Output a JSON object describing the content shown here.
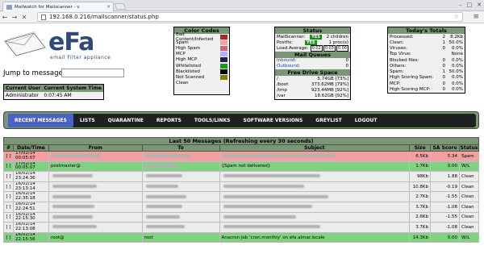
{
  "browser": {
    "tab_title": "Mailwatch for Mailscanner - v",
    "url": "192.168.0.216/mailscanner/status.php",
    "back": "←",
    "forward": "→",
    "reload": "✕",
    "menu": "≡",
    "star": "☆"
  },
  "logo": {
    "text": "eFa",
    "subtitle": "email Filter appliance"
  },
  "jump": {
    "label": "Jump to message:",
    "value": ""
  },
  "user_table": {
    "headers": [
      "Current User",
      "Current System Time"
    ],
    "user": "Administrator",
    "time": "0:07:45 AM"
  },
  "color_codes": {
    "title": "Color Codes",
    "items": [
      {
        "label": "Bad Content/Infected",
        "color": "#b22222"
      },
      {
        "label": "Spam",
        "color": "#f2a0a0"
      },
      {
        "label": "High Spam",
        "color": "#e0607a"
      },
      {
        "label": "MCP",
        "color": "#b0b0ff"
      },
      {
        "label": "High MCP",
        "color": "#202060"
      },
      {
        "label": "Whitelisted",
        "color": "#10a010"
      },
      {
        "label": "Blacklisted",
        "color": "#000000"
      },
      {
        "label": "Not Scanned",
        "color": "#808000"
      },
      {
        "label": "Clean",
        "color": "#f0f0f0"
      }
    ]
  },
  "status": {
    "title": "Status",
    "rows": [
      {
        "label": "MailScanner:",
        "badge": "YES",
        "value": "2 children"
      },
      {
        "label": "Postfix:",
        "badge": "YES",
        "value": "1 proc(s)"
      }
    ],
    "load_label": "Load Average:",
    "load": [
      "0.02",
      "0.03",
      "0.00"
    ]
  },
  "queues": {
    "title": "Mail Queues",
    "rows": [
      {
        "label": "Inbound:",
        "value": "0"
      },
      {
        "label": "Outbound:",
        "value": "0"
      }
    ]
  },
  "drives": {
    "title": "Free Drive Space",
    "rows": [
      {
        "label": "/",
        "value": "5.74GB [73%]"
      },
      {
        "label": "/boot",
        "value": "373.62MB [79%]"
      },
      {
        "label": "/tmp",
        "value": "923.44MB [92%]"
      },
      {
        "label": "/var",
        "value": "18.62GB [92%]"
      }
    ]
  },
  "totals": {
    "title": "Today's Totals",
    "rows": [
      {
        "label": "Processed:",
        "n": "2",
        "v": "8.2Kb"
      },
      {
        "label": "Clean:",
        "n": "1",
        "v": "50.0%"
      },
      {
        "label": "Viruses:",
        "n": "0",
        "v": "0.0%"
      },
      {
        "label": "Top Virus:",
        "n": "",
        "v": "None"
      },
      {
        "label": "Blocked files:",
        "n": "0",
        "v": "0.0%"
      },
      {
        "label": "Others:",
        "n": "0",
        "v": "0.0%"
      },
      {
        "label": "Spam:",
        "n": "1",
        "v": "50.0%"
      },
      {
        "label": "High Scoring Spam:",
        "n": "0",
        "v": "0.0%"
      },
      {
        "label": "MCP:",
        "n": "0",
        "v": "0.0%"
      },
      {
        "label": "High Scoring MCP:",
        "n": "0",
        "v": "0.0%"
      }
    ]
  },
  "nav": [
    "RECENT MESSAGES",
    "LISTS",
    "QUARANTINE",
    "REPORTS",
    "TOOLS/LINKS",
    "SOFTWARE VERSIONS",
    "GREYLIST",
    "LOGOUT"
  ],
  "messages": {
    "caption": "Last 50 Messages (Refreshing every 30 seconds)",
    "headers": [
      "#",
      "Date/Time",
      "From",
      "To",
      "Subject",
      "Size",
      "SA Score",
      "Status"
    ],
    "rows": [
      {
        "cls": "spam",
        "mark": "[ ]",
        "date": "17/02/14",
        "time": "00:05:07",
        "from": "",
        "to": "",
        "subject": "",
        "size": "6.5Kb",
        "score": "5.34",
        "status": "Spam"
      },
      {
        "cls": "wl",
        "mark": "[ ]",
        "date": "17/02/14",
        "time": "00:05:07",
        "from": "postmaster@",
        "to": "",
        "subject": "{Spam not delivered}",
        "size": "1.7Kb",
        "score": "0.00",
        "status": "W/L"
      },
      {
        "cls": "clean",
        "mark": "[ ]",
        "date": "16/02/14",
        "time": "23:24:36",
        "from": "",
        "to": "",
        "subject": "",
        "size": "98Kb",
        "score": "1.88",
        "status": "Clean"
      },
      {
        "cls": "clean",
        "mark": "[ ]",
        "date": "16/02/14",
        "time": "23:13:14",
        "from": "",
        "to": "",
        "subject": "",
        "size": "10.8Kb",
        "score": "-0.19",
        "status": "Clean"
      },
      {
        "cls": "clean",
        "mark": "[ ]",
        "date": "16/02/14",
        "time": "22:35:18",
        "from": "",
        "to": "",
        "subject": "",
        "size": "2.7Kb",
        "score": "-1.55",
        "status": "Clean"
      },
      {
        "cls": "clean",
        "mark": "[ ]",
        "date": "16/02/14",
        "time": "22:24:51",
        "from": "",
        "to": "",
        "subject": "",
        "size": "3.7Kb",
        "score": "-1.08",
        "status": "Clean"
      },
      {
        "cls": "clean",
        "mark": "[ ]",
        "date": "16/02/14",
        "time": "22:15:30",
        "from": "",
        "to": "",
        "subject": "",
        "size": "2.6Kb",
        "score": "-1.55",
        "status": "Clean"
      },
      {
        "cls": "clean",
        "mark": "[ ]",
        "date": "16/02/14",
        "time": "22:13:08",
        "from": "",
        "to": "",
        "subject": "",
        "size": "3.7Kb",
        "score": "-1.08",
        "status": "Clean"
      },
      {
        "cls": "wl",
        "mark": "[ ]",
        "date": "16/02/14",
        "time": "22:15:56",
        "from": "root@",
        "to": "root",
        "subject": "Anacron job 'cron.monthly' on efa.almar.locale",
        "size": "14.3Kb",
        "score": "0.00",
        "status": "W/L"
      }
    ]
  }
}
